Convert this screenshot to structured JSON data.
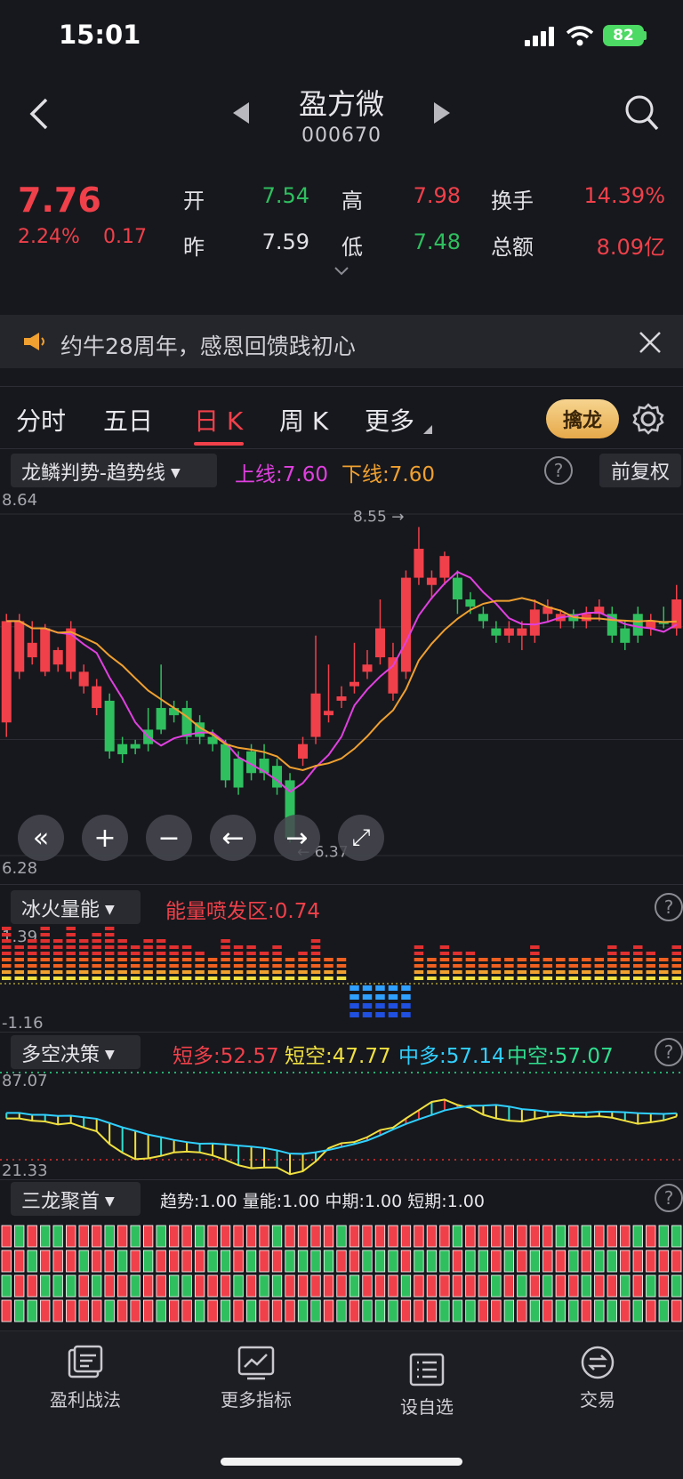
{
  "status": {
    "time": "15:01",
    "battery": "82"
  },
  "header": {
    "stock_name": "盈方微",
    "stock_code": "000670"
  },
  "quote": {
    "price": "7.76",
    "change_pct": "2.24%",
    "change": "0.17",
    "open_label": "开",
    "open": "7.54",
    "high_label": "高",
    "high": "7.98",
    "turnover_label": "换手",
    "turnover": "14.39%",
    "prev_label": "昨",
    "prev": "7.59",
    "low_label": "低",
    "low": "7.48",
    "amount_label": "总额",
    "amount": "8.09亿"
  },
  "banner": {
    "text": "约牛28周年，感恩回馈践初心"
  },
  "tabs": [
    "分时",
    "五日",
    "日 K",
    "周 K",
    "更多"
  ],
  "qinlong_label": "擒龙",
  "main_chart": {
    "indicator": "龙鳞判势-趋势线",
    "upper_label": "上线:7.60",
    "lower_label": "下线:7.60",
    "fuquan": "前复权",
    "y_max": "8.64",
    "y_min": "6.28",
    "max_marker": "8.55",
    "min_marker": "6.37"
  },
  "energy_panel": {
    "indicator": "冰火量能",
    "label": "能量喷发区:0.74",
    "y_max": "1.39",
    "y_min": "-1.16"
  },
  "duokong_panel": {
    "indicator": "多空决策",
    "short_long": "短多:52.57",
    "short_short": "短空:47.77",
    "mid_long": "中多:57.14",
    "mid_short": "中空:57.07",
    "y_max": "87.07",
    "y_min": "21.33"
  },
  "sanlong_panel": {
    "indicator": "三龙聚首",
    "label": "趋势:1.00 量能:1.00 中期:1.00 短期:1.00"
  },
  "bottom_nav": [
    {
      "label": "盈利战法",
      "icon": "strategy-icon"
    },
    {
      "label": "更多指标",
      "icon": "indicator-chart-icon"
    },
    {
      "label": "设自选",
      "icon": "watchlist-icon"
    },
    {
      "label": "交易",
      "icon": "trade-exchange-icon"
    }
  ],
  "colors": {
    "up": "#f0404a",
    "down": "#2fbf5f",
    "ma_short": "#e040e0",
    "ma_long": "#f0a030",
    "bg": "#17181d"
  },
  "chart_data": {
    "type": "candlestick",
    "ylim": [
      6.28,
      8.64
    ],
    "candles": [
      {
        "o": 7.2,
        "c": 7.9,
        "h": 7.95,
        "l": 7.1
      },
      {
        "o": 7.55,
        "c": 7.9,
        "h": 7.95,
        "l": 7.5
      },
      {
        "o": 7.65,
        "c": 7.75,
        "h": 7.9,
        "l": 7.6
      },
      {
        "o": 7.55,
        "c": 7.85,
        "h": 7.88,
        "l": 7.52
      },
      {
        "o": 7.6,
        "c": 7.7,
        "h": 7.72,
        "l": 7.55
      },
      {
        "o": 7.55,
        "c": 7.85,
        "h": 7.9,
        "l": 7.5
      },
      {
        "o": 7.45,
        "c": 7.55,
        "h": 7.6,
        "l": 7.4
      },
      {
        "o": 7.3,
        "c": 7.45,
        "h": 7.5,
        "l": 7.25
      },
      {
        "o": 7.35,
        "c": 7.0,
        "h": 7.4,
        "l": 6.95
      },
      {
        "o": 7.05,
        "c": 6.98,
        "h": 7.1,
        "l": 6.92
      },
      {
        "o": 7.05,
        "c": 7.02,
        "h": 7.08,
        "l": 6.98
      },
      {
        "o": 7.15,
        "c": 7.05,
        "h": 7.3,
        "l": 7.0
      },
      {
        "o": 7.3,
        "c": 7.15,
        "h": 7.6,
        "l": 7.12
      },
      {
        "o": 7.3,
        "c": 7.25,
        "h": 7.35,
        "l": 7.2
      },
      {
        "o": 7.3,
        "c": 7.1,
        "h": 7.35,
        "l": 7.05
      },
      {
        "o": 7.2,
        "c": 7.1,
        "h": 7.25,
        "l": 7.05
      },
      {
        "o": 7.1,
        "c": 7.05,
        "h": 7.15,
        "l": 7.0
      },
      {
        "o": 7.05,
        "c": 6.8,
        "h": 7.08,
        "l": 6.75
      },
      {
        "o": 6.95,
        "c": 6.75,
        "h": 7.0,
        "l": 6.7
      },
      {
        "o": 7.0,
        "c": 6.85,
        "h": 7.05,
        "l": 6.8
      },
      {
        "o": 6.95,
        "c": 6.85,
        "h": 7.05,
        "l": 6.8
      },
      {
        "o": 6.9,
        "c": 6.75,
        "h": 6.95,
        "l": 6.7
      },
      {
        "o": 6.8,
        "c": 6.4,
        "h": 6.85,
        "l": 6.37
      },
      {
        "o": 6.95,
        "c": 7.05,
        "h": 7.1,
        "l": 6.9
      },
      {
        "o": 7.1,
        "c": 7.4,
        "h": 7.8,
        "l": 7.05
      },
      {
        "o": 7.25,
        "c": 7.28,
        "h": 7.6,
        "l": 7.2
      },
      {
        "o": 7.35,
        "c": 7.38,
        "h": 7.45,
        "l": 7.3
      },
      {
        "o": 7.45,
        "c": 7.48,
        "h": 7.75,
        "l": 7.4
      },
      {
        "o": 7.55,
        "c": 7.6,
        "h": 7.7,
        "l": 7.5
      },
      {
        "o": 7.65,
        "c": 7.85,
        "h": 8.05,
        "l": 7.6
      },
      {
        "o": 7.4,
        "c": 7.65,
        "h": 7.75,
        "l": 7.35
      },
      {
        "o": 7.55,
        "c": 8.2,
        "h": 8.25,
        "l": 7.5
      },
      {
        "o": 8.2,
        "c": 8.4,
        "h": 8.55,
        "l": 8.15
      },
      {
        "o": 8.15,
        "c": 8.2,
        "h": 8.25,
        "l": 8.05
      },
      {
        "o": 8.2,
        "c": 8.35,
        "h": 8.38,
        "l": 8.15
      },
      {
        "o": 8.2,
        "c": 8.05,
        "h": 8.25,
        "l": 7.95
      },
      {
        "o": 8.05,
        "c": 8.0,
        "h": 8.1,
        "l": 7.95
      },
      {
        "o": 7.95,
        "c": 7.9,
        "h": 8.0,
        "l": 7.85
      },
      {
        "o": 7.85,
        "c": 7.8,
        "h": 7.9,
        "l": 7.75
      },
      {
        "o": 7.8,
        "c": 7.85,
        "h": 7.9,
        "l": 7.75
      },
      {
        "o": 7.8,
        "c": 7.85,
        "h": 7.9,
        "l": 7.7
      },
      {
        "o": 7.8,
        "c": 7.98,
        "h": 8.05,
        "l": 7.75
      },
      {
        "o": 7.95,
        "c": 8.0,
        "h": 8.05,
        "l": 7.9
      },
      {
        "o": 7.9,
        "c": 7.95,
        "h": 7.98,
        "l": 7.85
      },
      {
        "o": 7.95,
        "c": 7.9,
        "h": 7.98,
        "l": 7.85
      },
      {
        "o": 7.9,
        "c": 7.95,
        "h": 8.0,
        "l": 7.85
      },
      {
        "o": 7.95,
        "c": 8.0,
        "h": 8.05,
        "l": 7.9
      },
      {
        "o": 7.95,
        "c": 7.8,
        "h": 8.0,
        "l": 7.75
      },
      {
        "o": 7.85,
        "c": 7.75,
        "h": 7.9,
        "l": 7.7
      },
      {
        "o": 7.95,
        "c": 7.8,
        "h": 8.0,
        "l": 7.75
      },
      {
        "o": 7.85,
        "c": 7.9,
        "h": 7.95,
        "l": 7.8
      },
      {
        "o": 7.9,
        "c": 7.88,
        "h": 8.0,
        "l": 7.85
      },
      {
        "o": 7.85,
        "c": 8.05,
        "h": 8.15,
        "l": 7.8
      }
    ]
  }
}
